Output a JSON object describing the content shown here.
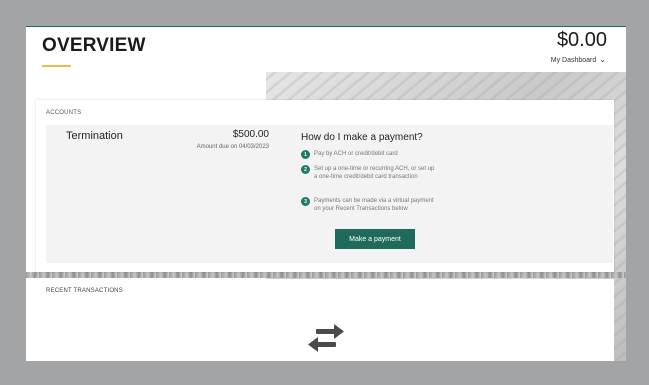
{
  "header": {
    "page_title": "OVERVIEW",
    "balance": "$0.00",
    "balance_link": "My Dashboard"
  },
  "accounts": {
    "heading": "ACCOUNTS",
    "item": {
      "name": "Termination",
      "amount": "$500.00",
      "due_date": "Amount due on 04/03/2023"
    }
  },
  "payment_help": {
    "title": "How do I make a payment?",
    "steps": [
      {
        "num": "1",
        "text": "Pay by ACH or credit/debit card"
      },
      {
        "num": "2",
        "text": "Set up a one-time or recurring ACH, or set up a one-time credit/debit card transaction"
      },
      {
        "num": "3",
        "text": "Payments can be made via a virtual payment on your Recent Transactions below"
      }
    ],
    "button_label": "Make a payment"
  },
  "transactions": {
    "heading": "RECENT TRANSACTIONS"
  },
  "icons": {
    "balance_dropdown": "chevron-down-icon",
    "transactions_empty": "swap-arrows-icon"
  },
  "colors": {
    "accent_green": "#1e6b5a",
    "title_underline": "#f0b94a",
    "page_background": "#a3a4a6"
  }
}
